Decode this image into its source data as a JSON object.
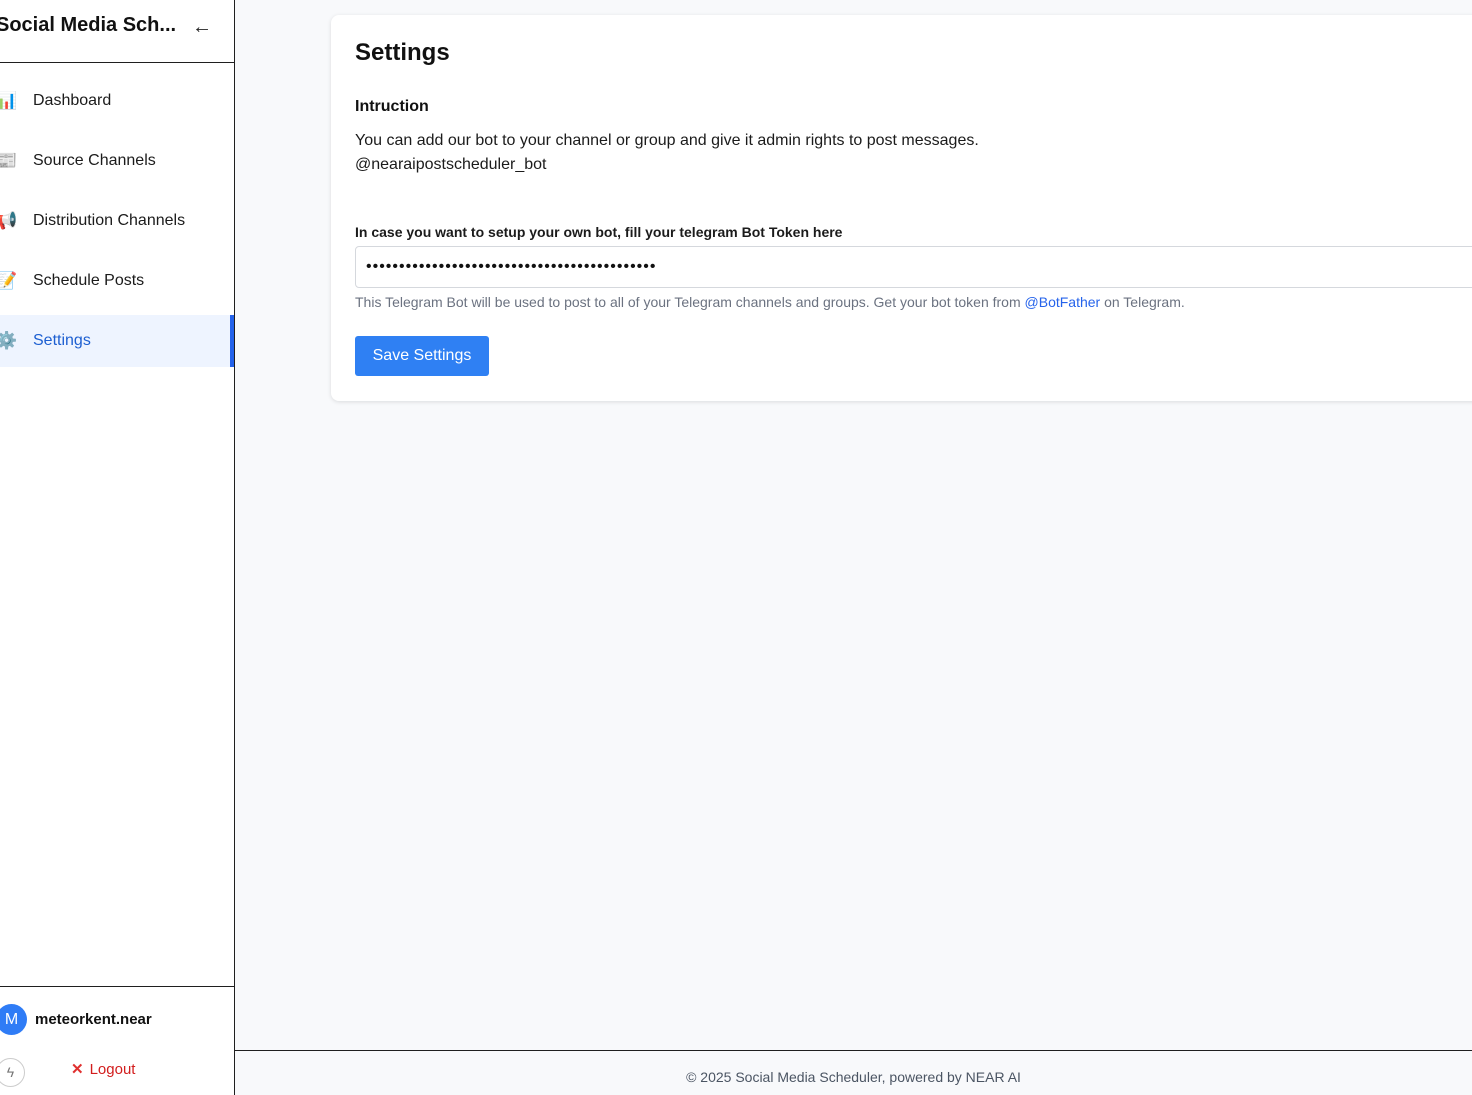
{
  "sidebar": {
    "app_title": "Social Media Sch...",
    "collapse_icon": "←",
    "items": [
      {
        "icon": "📊",
        "icon_name": "bar-chart-icon",
        "label": "Dashboard",
        "active": false
      },
      {
        "icon": "📰",
        "icon_name": "newspaper-icon",
        "label": "Source Channels",
        "active": false
      },
      {
        "icon": "📢",
        "icon_name": "megaphone-icon",
        "label": "Distribution Channels",
        "active": false
      },
      {
        "icon": "📝",
        "icon_name": "memo-icon",
        "label": "Schedule Posts",
        "active": false
      },
      {
        "icon": "⚙️",
        "icon_name": "gear-icon",
        "label": "Settings",
        "active": true
      }
    ],
    "user": {
      "avatar_initial": "M",
      "name": "meteorkent.near"
    },
    "bolt_icon": "ϟ",
    "logout_icon": "✕",
    "logout_label": "Logout"
  },
  "main": {
    "title": "Settings",
    "section_title": "Intruction",
    "instruction_text": "You can add our bot to your channel or group and give it admin rights to post messages.",
    "bot_handle": "@nearaipostscheduler_bot",
    "token_label": "In case you want to setup your own bot, fill your telegram Bot Token here",
    "token_value": "............................................",
    "help_prefix": "This Telegram Bot will be used to post to all of your Telegram channels and groups. Get your bot token from ",
    "help_link": "@BotFather",
    "help_suffix": " on Telegram.",
    "save_label": "Save Settings"
  },
  "footer": {
    "text": "© 2025 Social Media Scheduler, powered by NEAR AI"
  },
  "colors": {
    "accent": "#2f80f3",
    "active_nav_bg": "#eef4ff",
    "active_nav_bar": "#2563eb",
    "logout": "#d21d1d"
  }
}
